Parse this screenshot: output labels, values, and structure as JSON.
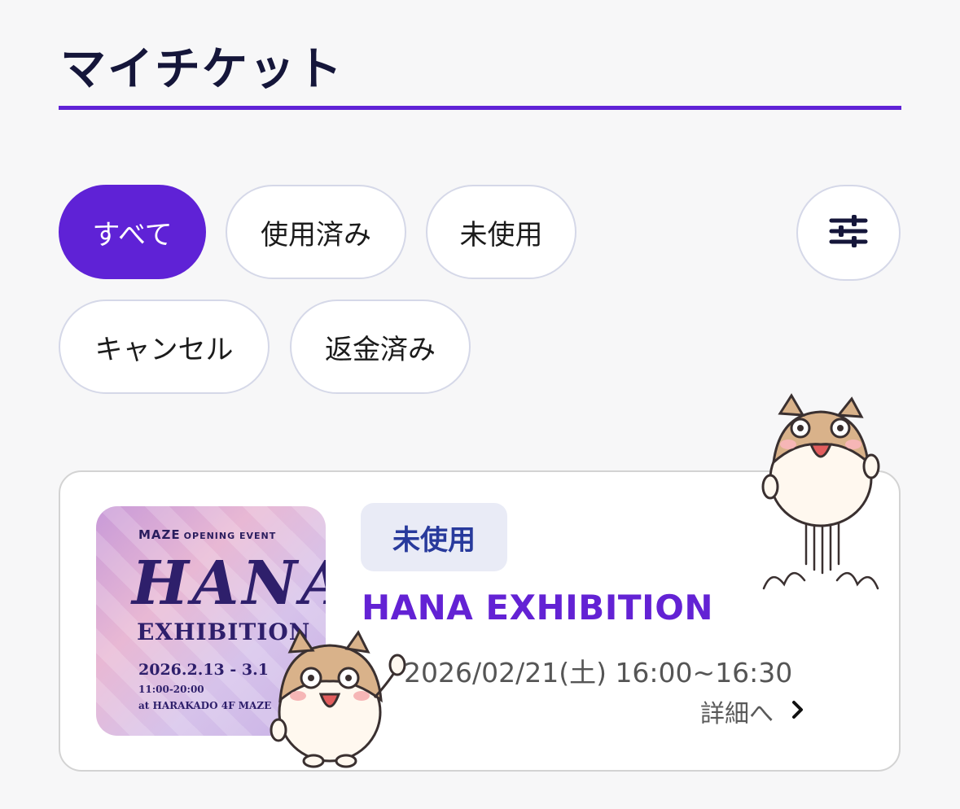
{
  "page": {
    "title": "マイチケット"
  },
  "filters": {
    "chips": [
      {
        "label": "すべて",
        "active": true
      },
      {
        "label": "使用済み",
        "active": false
      },
      {
        "label": "未使用",
        "active": false
      },
      {
        "label": "キャンセル",
        "active": false
      },
      {
        "label": "返金済み",
        "active": false
      }
    ],
    "settings_icon": "sliders-icon"
  },
  "ticket": {
    "status": "未使用",
    "title": "HANA EXHIBITION",
    "datetime": "2026/02/21(土) 16:00~16:30",
    "detail_label": "詳細へ",
    "thumbnail": {
      "brand": "MAZE",
      "brand_sub": "OPENING EVENT",
      "headline": "HANA",
      "subhead": "EXHIBITION",
      "dates": "2026.2.13 - 3.1",
      "hours": "11:00-20:00",
      "venue": "at HARAKADO 4F MAZE"
    }
  },
  "colors": {
    "accent": "#5f22d6",
    "title_text": "#15163a",
    "badge_bg": "#e9ebf6",
    "badge_text": "#283a9c",
    "event_title": "#6322d4"
  }
}
